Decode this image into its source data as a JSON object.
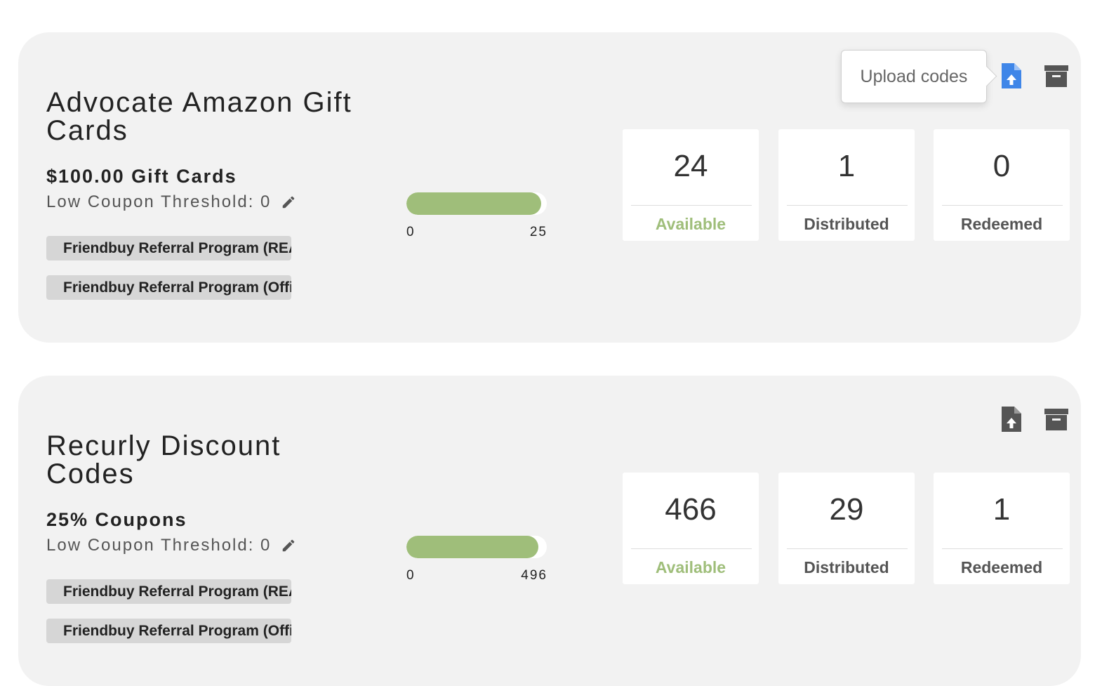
{
  "colors": {
    "accent_green": "#9fbe7a",
    "card_bg": "#f2f2f2",
    "upload_active": "#3f86e8",
    "icon_gray": "#555555"
  },
  "tooltip": {
    "text": "Upload codes"
  },
  "cards": [
    {
      "title_line1": "Advocate Amazon Gift",
      "title_line2": "Cards",
      "subtitle": "$100.00 Gift Cards",
      "threshold": "Low Coupon Threshold: 0",
      "tags": [
        "Friendbuy Referral Program (REAL)",
        "Friendbuy Referral Program (Official)"
      ],
      "progress": {
        "min": "0",
        "max": "25",
        "value": 24,
        "total": 25
      },
      "stats": [
        {
          "value": "24",
          "label": "Available"
        },
        {
          "value": "1",
          "label": "Distributed"
        },
        {
          "value": "0",
          "label": "Redeemed"
        }
      ],
      "icons": {
        "upload": "upload-file-icon",
        "archive": "archive-icon",
        "upload_active": true
      }
    },
    {
      "title_line1": "Recurly Discount",
      "title_line2": "Codes",
      "subtitle": "25% Coupons",
      "threshold": "Low Coupon Threshold: 0",
      "tags": [
        "Friendbuy Referral Program (REAL)",
        "Friendbuy Referral Program (Official)"
      ],
      "progress": {
        "min": "0",
        "max": "496",
        "value": 466,
        "total": 496
      },
      "stats": [
        {
          "value": "466",
          "label": "Available"
        },
        {
          "value": "29",
          "label": "Distributed"
        },
        {
          "value": "1",
          "label": "Redeemed"
        }
      ],
      "icons": {
        "upload": "upload-file-icon",
        "archive": "archive-icon",
        "upload_active": false
      }
    }
  ]
}
